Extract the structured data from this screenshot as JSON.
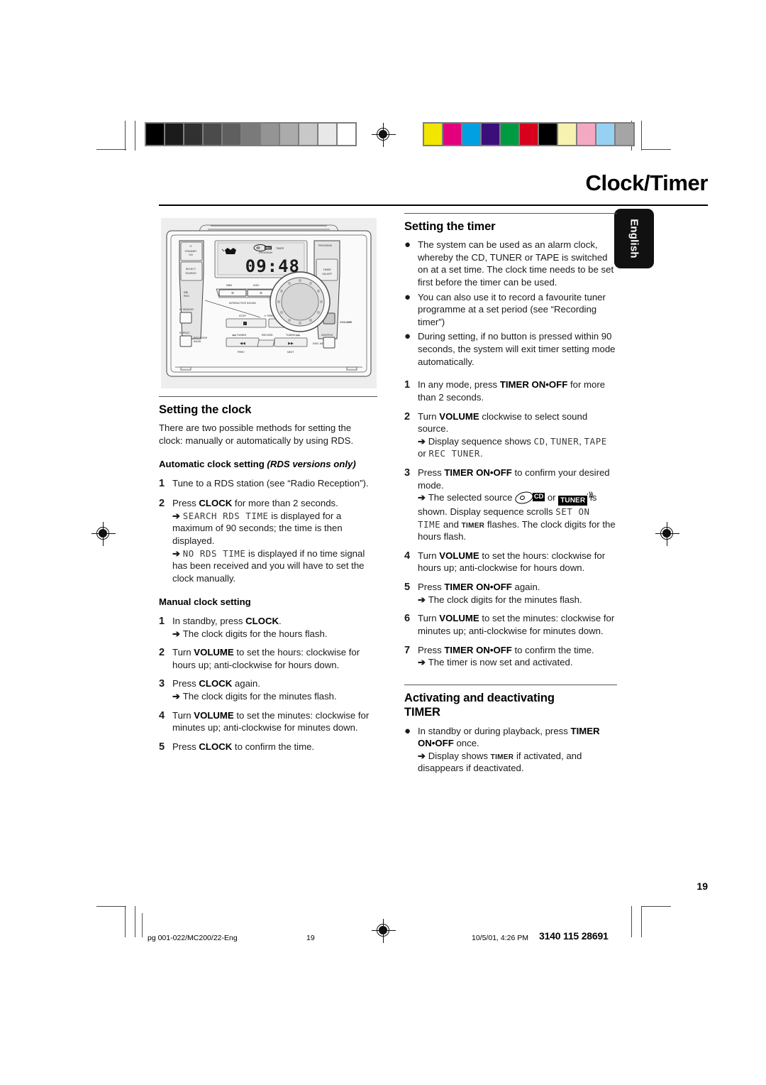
{
  "page": {
    "title": "Clock/Timer",
    "language_tab": "English",
    "page_number": "19"
  },
  "calibration": {
    "grayscale_label": "grayscale-calibration-strip",
    "grayscale": [
      "#000000",
      "#1b1b1b",
      "#313131",
      "#4b4b4b",
      "#5f5f5f",
      "#7a7a7a",
      "#949494",
      "#ababab",
      "#c8c8c8",
      "#e8e8e8",
      "#ffffff"
    ],
    "colorbar_label": "color-calibration-strip",
    "colors": [
      "#f2e500",
      "#e2007d",
      "#00a0e2",
      "#3b0f7a",
      "#009a40",
      "#d8001c",
      "#000000",
      "#f7f2b0",
      "#f4a9c2",
      "#97d1f2",
      "#a5a5a5"
    ]
  },
  "device": {
    "display_time": "09:48",
    "display_timer_label": "TIMER",
    "display_program_label": "PROGRAM",
    "buttons": {
      "standby": "STANDBY\nON",
      "select_source": "SELECT\nSOURCE",
      "program": "PROGRAM",
      "timer_on_off": "TIMER\nON·OFF",
      "ir_sensor": "IR SENSOR",
      "repeat": "REPEAT",
      "rev_mode_band": "REV MODE\nBAND",
      "clock": "CLOCK",
      "rds": "RDS",
      "shuffle": "SHUFFLE",
      "disc_change": "DISC A/B",
      "volume": "VOLUME",
      "dbb": "DBB",
      "disc": "DISC",
      "incredible_surround": "INCREDIBLE SURROUND",
      "interactive_sound": "INTERACTIVE SOUND",
      "stop": "STOP",
      "preset": "PRESET",
      "play_pause": "PLAY•PAUSE",
      "tuning_down": "TUNING",
      "record": "RECORD",
      "tuning_up": "TUNING",
      "prev": "PREV",
      "next": "NEXT",
      "cd_rds_logo": "CD RDS"
    }
  },
  "left_column": {
    "heading": "Setting the clock",
    "intro": "There are two possible methods for setting the clock: manually or automatically by using RDS.",
    "auto_heading_plain": "Automatic clock setting ",
    "auto_heading_italic": "(RDS versions only)",
    "auto_steps": [
      {
        "num": "1",
        "parts": [
          {
            "t": "Tune to a RDS station (see “Radio Reception”)."
          }
        ]
      },
      {
        "num": "2",
        "parts": [
          {
            "t": "Press "
          },
          {
            "t": "CLOCK",
            "bold": true
          },
          {
            "t": " for more than 2 seconds."
          }
        ],
        "results": [
          {
            "parts": [
              {
                "t": "SEARCH RDS TIME",
                "lcd": true
              },
              {
                "t": " is displayed for a maximum of 90 seconds; the time is then displayed."
              }
            ]
          },
          {
            "parts": [
              {
                "t": "NO RDS TIME",
                "lcd": true
              },
              {
                "t": " is displayed if no time signal has been received and you will have to set the clock manually."
              }
            ]
          }
        ]
      }
    ],
    "manual_heading": "Manual clock setting",
    "manual_steps": [
      {
        "num": "1",
        "parts": [
          {
            "t": "In standby, press "
          },
          {
            "t": "CLOCK",
            "bold": true
          },
          {
            "t": "."
          }
        ],
        "results": [
          {
            "parts": [
              {
                "t": "The clock digits for the hours flash."
              }
            ]
          }
        ]
      },
      {
        "num": "2",
        "parts": [
          {
            "t": "Turn "
          },
          {
            "t": "VOLUME",
            "bold": true
          },
          {
            "t": " to set the hours: clockwise for hours up; anti-clockwise for hours down."
          }
        ]
      },
      {
        "num": "3",
        "parts": [
          {
            "t": "Press "
          },
          {
            "t": "CLOCK",
            "bold": true
          },
          {
            "t": " again."
          }
        ],
        "results": [
          {
            "parts": [
              {
                "t": "The clock digits for the minutes flash."
              }
            ]
          }
        ]
      },
      {
        "num": "4",
        "parts": [
          {
            "t": "Turn "
          },
          {
            "t": "VOLUME",
            "bold": true
          },
          {
            "t": " to set the minutes: clockwise for minutes up; anti-clockwise for minutes down."
          }
        ]
      },
      {
        "num": "5",
        "parts": [
          {
            "t": "Press "
          },
          {
            "t": "CLOCK",
            "bold": true
          },
          {
            "t": " to confirm the time."
          }
        ]
      }
    ]
  },
  "right_column": {
    "heading": "Setting the timer",
    "bullets": [
      "The system can be used as an alarm clock, whereby the CD, TUNER or TAPE is switched on at a set time. The clock time needs to be set first before the timer can be used.",
      "You can also use it to record a favourite tuner programme at a set period (see “Recording timer”)",
      "During setting, if no button is pressed within 90 seconds, the system will exit timer setting mode automatically."
    ],
    "steps": [
      {
        "num": "1",
        "parts": [
          {
            "t": "In any mode, press "
          },
          {
            "t": "TIMER ON•OFF",
            "bold": true
          },
          {
            "t": " for more than 2 seconds."
          }
        ]
      },
      {
        "num": "2",
        "parts": [
          {
            "t": "Turn "
          },
          {
            "t": "VOLUME",
            "bold": true
          },
          {
            "t": " clockwise to select sound source."
          }
        ],
        "results": [
          {
            "parts": [
              {
                "t": "Display sequence shows "
              },
              {
                "t": "CD",
                "lcd": true
              },
              {
                "t": ", "
              },
              {
                "t": "TUNER",
                "lcd": true
              },
              {
                "t": ", "
              },
              {
                "t": "TAPE",
                "lcd": true
              },
              {
                "t": " or "
              },
              {
                "t": "REC TUNER",
                "lcd": true
              },
              {
                "t": "."
              }
            ]
          }
        ]
      },
      {
        "num": "3",
        "parts": [
          {
            "t": "Press "
          },
          {
            "t": "TIMER ON•OFF",
            "bold": true
          },
          {
            "t": " to confirm your desired mode."
          }
        ],
        "results": [
          {
            "parts": [
              {
                "t": "The selected source "
              },
              {
                "glyph": "cd"
              },
              {
                "t": " or "
              },
              {
                "glyph": "tuner"
              },
              {
                "t": " is shown. Display sequence scrolls "
              },
              {
                "t": "SET ON TIME",
                "lcd": true
              },
              {
                "t": " and "
              },
              {
                "t": "TIMER",
                "smallcap": true
              },
              {
                "t": " flashes. The clock digits for the hours flash."
              }
            ]
          }
        ]
      },
      {
        "num": "4",
        "parts": [
          {
            "t": "Turn "
          },
          {
            "t": "VOLUME",
            "bold": true
          },
          {
            "t": " to set the hours: clockwise for hours up; anti-clockwise for hours down."
          }
        ]
      },
      {
        "num": "5",
        "parts": [
          {
            "t": "Press "
          },
          {
            "t": "TIMER ON•OFF",
            "bold": true
          },
          {
            "t": " again."
          }
        ],
        "results": [
          {
            "parts": [
              {
                "t": "The clock digits for the minutes flash."
              }
            ]
          }
        ]
      },
      {
        "num": "6",
        "parts": [
          {
            "t": "Turn "
          },
          {
            "t": "VOLUME",
            "bold": true
          },
          {
            "t": " to set the minutes: clockwise for minutes up; anti-clockwise for minutes down."
          }
        ]
      },
      {
        "num": "7",
        "parts": [
          {
            "t": "Press "
          },
          {
            "t": "TIMER ON•OFF",
            "bold": true
          },
          {
            "t": " to confirm the time."
          }
        ],
        "results": [
          {
            "parts": [
              {
                "t": "The timer is now set and activated."
              }
            ]
          }
        ]
      }
    ],
    "activate_heading_line1": "Activating and deactivating",
    "activate_heading_line2": "TIMER",
    "activate_bullet": {
      "parts": [
        {
          "t": "In standby or during playback, press "
        },
        {
          "t": "TIMER ON•OFF",
          "bold": true
        },
        {
          "t": " once."
        }
      ],
      "results": [
        {
          "parts": [
            {
              "t": "Display shows "
            },
            {
              "t": "TIMER",
              "smallcap": true
            },
            {
              "t": " if activated, and disappears if deactivated."
            }
          ]
        }
      ]
    }
  },
  "footer": {
    "file": "pg 001-022/MC200/22-Eng",
    "page": "19",
    "timestamp": "10/5/01, 4:26 PM",
    "code": "3140 115 28691"
  }
}
